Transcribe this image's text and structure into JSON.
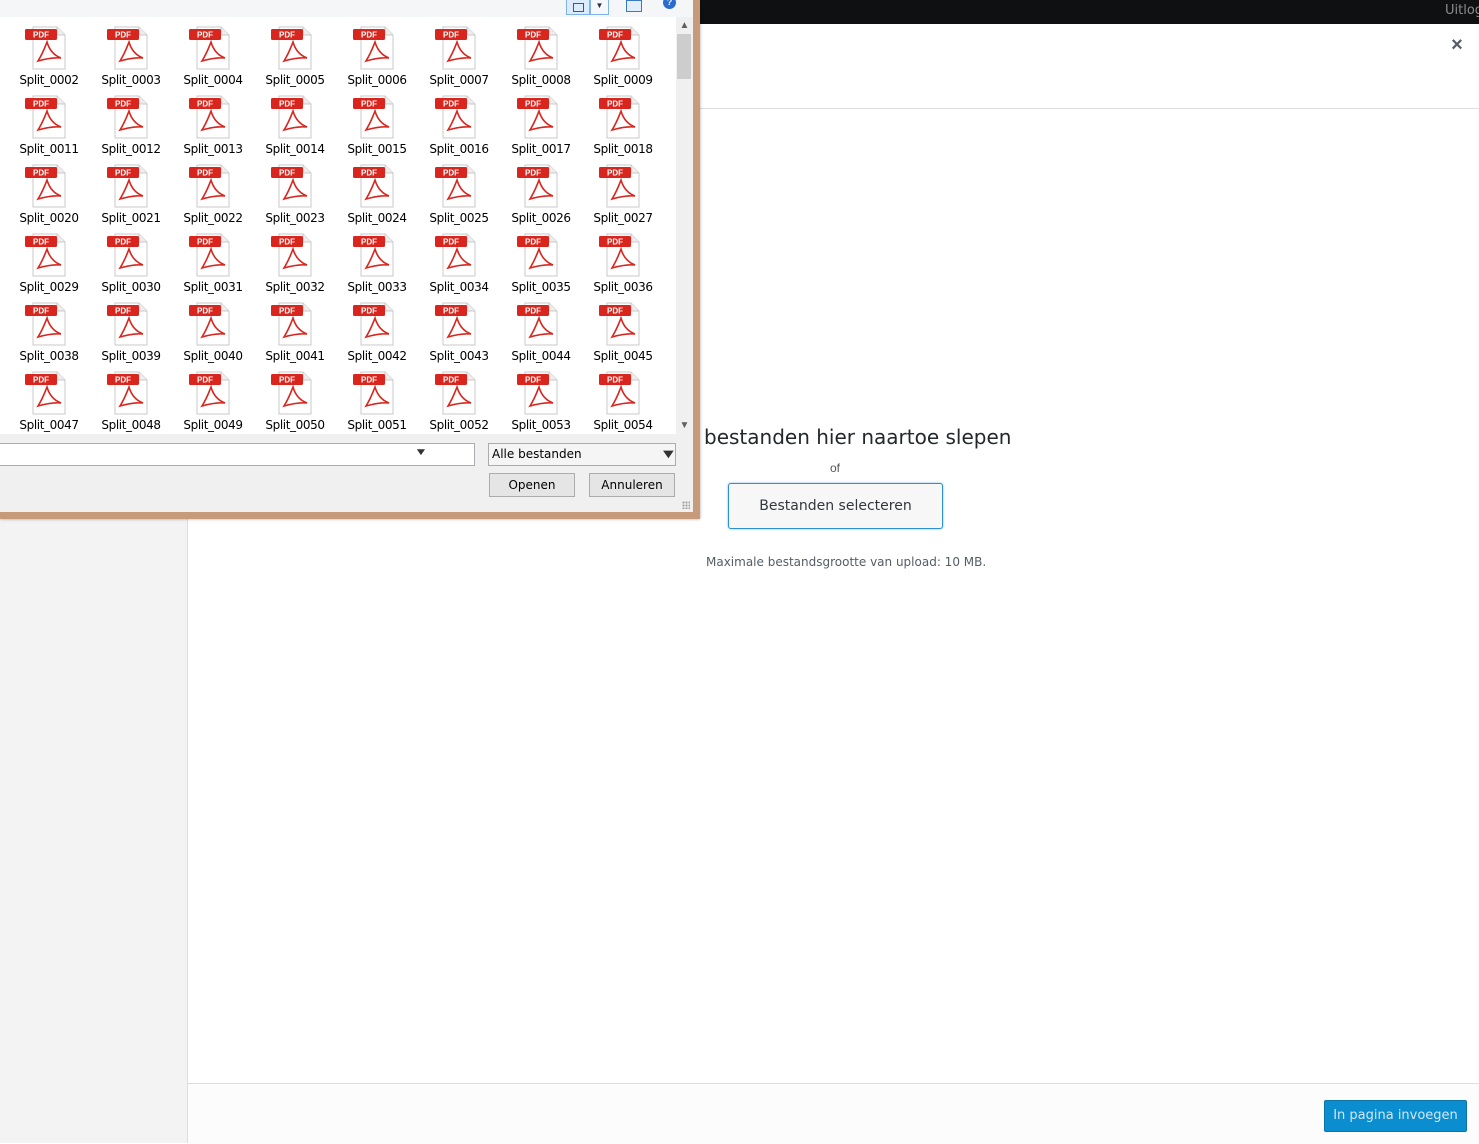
{
  "admin_bar": {
    "right_text": "Uitlog"
  },
  "media_modal": {
    "close_label": "×",
    "upload": {
      "drop_title": "bestanden hier naartoe slepen",
      "or_text": "of",
      "select_button": "Bestanden selecteren",
      "max_size": "Maximale bestandsgrootte van upload: 10 MB."
    },
    "footer": {
      "insert_button": "In pagina invoegen"
    }
  },
  "file_dialog": {
    "help_icon": "?",
    "files": [
      "Split_0002",
      "Split_0003",
      "Split_0004",
      "Split_0005",
      "Split_0006",
      "Split_0007",
      "Split_0008",
      "Split_0009",
      "Split_0011",
      "Split_0012",
      "Split_0013",
      "Split_0014",
      "Split_0015",
      "Split_0016",
      "Split_0017",
      "Split_0018",
      "Split_0020",
      "Split_0021",
      "Split_0022",
      "Split_0023",
      "Split_0024",
      "Split_0025",
      "Split_0026",
      "Split_0027",
      "Split_0029",
      "Split_0030",
      "Split_0031",
      "Split_0032",
      "Split_0033",
      "Split_0034",
      "Split_0035",
      "Split_0036",
      "Split_0038",
      "Split_0039",
      "Split_0040",
      "Split_0041",
      "Split_0042",
      "Split_0043",
      "Split_0044",
      "Split_0045",
      "Split_0047",
      "Split_0048",
      "Split_0049",
      "Split_0050",
      "Split_0051",
      "Split_0052",
      "Split_0053",
      "Split_0054"
    ],
    "file_icon_label": "PDF",
    "icon": "pdf-file-icon",
    "filename_value": "",
    "filter_selected": "Alle bestanden",
    "open_button": "Openen",
    "cancel_button": "Annuleren"
  },
  "colors": {
    "pdf_red": "#d8261e",
    "wp_primary": "#0b8ed0",
    "dialog_frame": "#c79b79"
  }
}
